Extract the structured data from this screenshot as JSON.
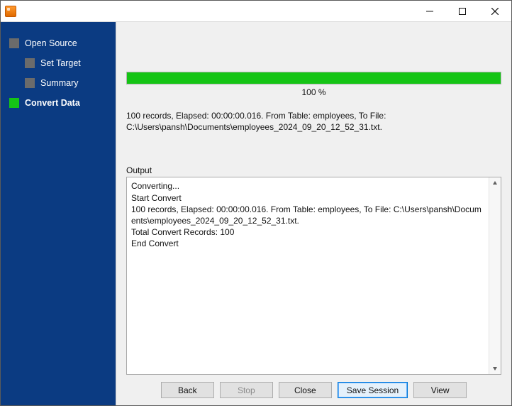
{
  "sidebar": {
    "items": [
      {
        "label": "Open Source",
        "level": 0,
        "active": false
      },
      {
        "label": "Set Target",
        "level": 1,
        "active": false
      },
      {
        "label": "Summary",
        "level": 1,
        "active": false
      },
      {
        "label": "Convert Data",
        "level": 0,
        "active": true
      }
    ]
  },
  "progress": {
    "percent": 100,
    "percent_label": "100 %"
  },
  "summary": {
    "line1": "100 records,    Elapsed: 00:00:00.016.    From Table: employees,    To File:",
    "line2": "C:\\Users\\pansh\\Documents\\employees_2024_09_20_12_52_31.txt."
  },
  "output": {
    "label": "Output",
    "lines": [
      "Converting...",
      "Start Convert",
      "100 records,    Elapsed: 00:00:00.016.    From Table: employees,    To File: C:\\Users\\pansh\\Documents\\employees_2024_09_20_12_52_31.txt.",
      "Total Convert Records: 100",
      "End Convert"
    ]
  },
  "buttons": {
    "back": "Back",
    "stop": "Stop",
    "close": "Close",
    "save": "Save Session",
    "view": "View"
  }
}
